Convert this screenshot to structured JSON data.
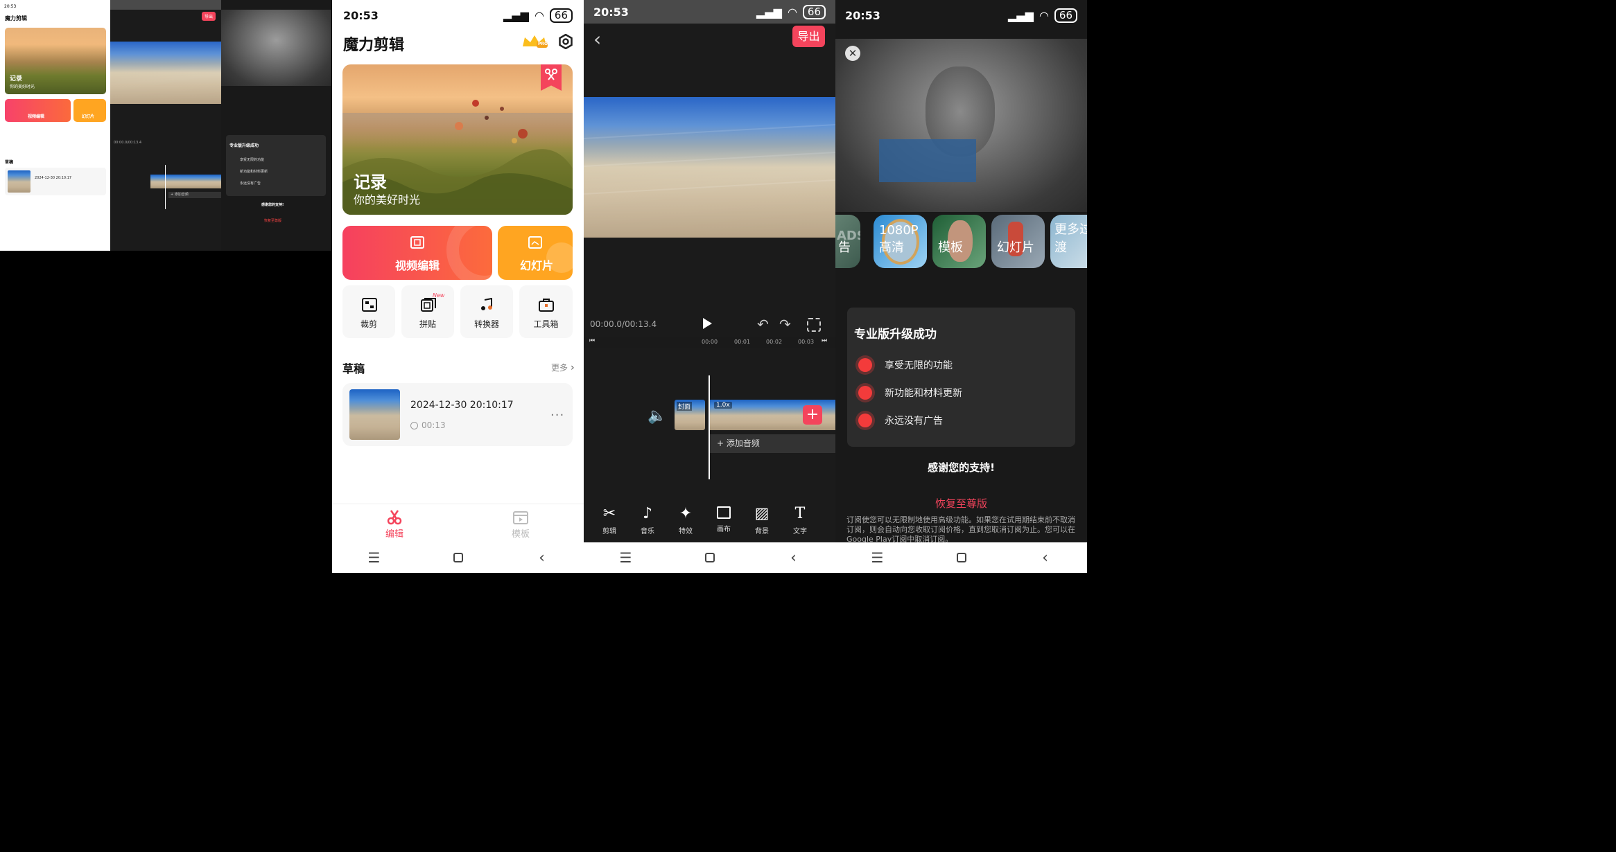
{
  "status": {
    "time": "20:53",
    "battery": "66"
  },
  "home": {
    "title": "魔力剪辑",
    "pro_badge": "PRO",
    "banner": {
      "title": "记录",
      "subtitle": "你的美好时光"
    },
    "actions": {
      "video_edit": "视频编辑",
      "slideshow": "幻灯片"
    },
    "tools": [
      {
        "label": "裁剪",
        "icon": "crop-icon"
      },
      {
        "label": "拼贴",
        "icon": "collage-icon",
        "badge": "New"
      },
      {
        "label": "转换器",
        "icon": "music-convert-icon"
      },
      {
        "label": "工具箱",
        "icon": "toolbox-icon"
      }
    ],
    "drafts": {
      "title": "草稿",
      "more": "更多",
      "item": {
        "date": "2024-12-30 20:10:17",
        "duration": "00:13"
      }
    },
    "tabs": {
      "edit": "编辑",
      "template": "模板"
    }
  },
  "editor": {
    "export": "导出",
    "timecode": "00:00.0/00:13.4",
    "ruler": [
      "00:00",
      "00:01",
      "00:02",
      "00:03"
    ],
    "cover_label": "封面",
    "speed_label": "1.0x",
    "add_audio": "+ 添加音频",
    "toolbar": [
      {
        "label": "剪辑",
        "icon": "scissors-icon"
      },
      {
        "label": "音乐",
        "icon": "music-icon"
      },
      {
        "label": "特效",
        "icon": "effects-icon"
      },
      {
        "label": "画布",
        "icon": "canvas-icon"
      },
      {
        "label": "背景",
        "icon": "background-icon"
      },
      {
        "label": "文字",
        "icon": "text-icon"
      }
    ]
  },
  "pro": {
    "categories": [
      "告",
      "1080P 高清",
      "模板",
      "幻灯片",
      "更多过渡"
    ],
    "ads_watermark": "ADS",
    "card_title": "专业版升级成功",
    "benefits": [
      "享受无限的功能",
      "新功能和材料更新",
      "永远没有广告"
    ],
    "thanks": "感谢您的支持!",
    "restore": "恢复至尊版",
    "legal": "订阅使您可以无限制地使用高级功能。如果您在试用期结束前不取消订阅，则会自动向您收取订阅价格，直到您取消订阅为止。您可以在Google Play订阅中取消订阅。"
  },
  "colors": {
    "accent_red": "#f4445c",
    "accent_orange": "#ffa521",
    "editor_bg": "#1b1b1b"
  }
}
